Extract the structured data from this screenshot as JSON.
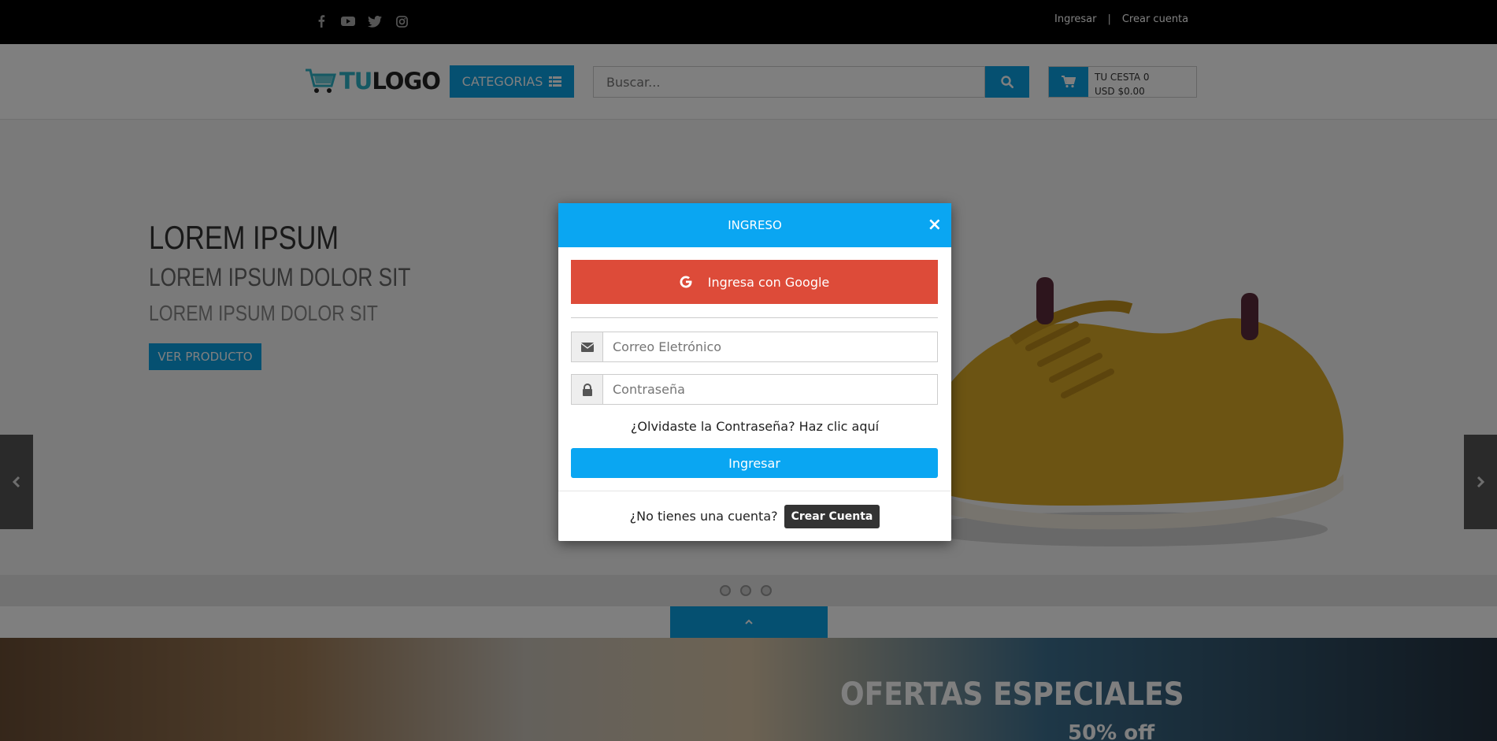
{
  "topbar": {
    "social_icons": [
      "facebook-icon",
      "youtube-icon",
      "twitter-icon",
      "instagram-icon"
    ],
    "login_link": "Ingresar",
    "separator": "|",
    "create_account_link": "Crear cuenta"
  },
  "header": {
    "logo_tu": "TU",
    "logo_rest": "LOGO",
    "categories_label": "CATEGORIAS",
    "search_placeholder": "Buscar...",
    "cart_line1": "TU CESTA 0",
    "cart_line2": "USD $0.00"
  },
  "hero": {
    "title1": "LOREM IPSUM",
    "title2": "LOREM IPSUM DOLOR SIT",
    "title3": "LOREM IPSUM DOLOR SIT",
    "cta": "VER PRODUCTO"
  },
  "promo": {
    "title": "OFERTAS ESPECIALES",
    "subtitle": "50% off"
  },
  "modal": {
    "title": "INGRESO",
    "close_glyph": "×",
    "google_label": "Ingresa con Google",
    "email_placeholder": "Correo Eletrónico",
    "password_placeholder": "Contraseña",
    "forgot_text": "¿Olvidaste la Contraseña? Haz clic aquí",
    "submit_label": "Ingresar",
    "no_account_text": "¿No tienes una cuenta?",
    "create_account_label": "Crear Cuenta"
  },
  "colors": {
    "primary": "#0aa0e3",
    "google": "#dd4b39",
    "topbar": "#000000"
  }
}
